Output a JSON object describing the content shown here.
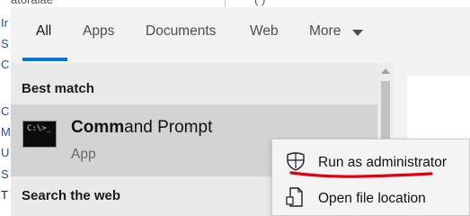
{
  "background": {
    "left_letters": [
      "Ir",
      "S",
      "C",
      "C",
      "M",
      "U",
      "S",
      "T"
    ],
    "top_fragment_left": "atoraiae",
    "top_fragment_right": "( )"
  },
  "tabs": [
    {
      "label": "All",
      "active": true
    },
    {
      "label": "Apps",
      "active": false
    },
    {
      "label": "Documents",
      "active": false
    },
    {
      "label": "Web",
      "active": false
    },
    {
      "label": "More",
      "active": false
    }
  ],
  "best_match": {
    "heading": "Best match",
    "item": {
      "title_bold": "Comm",
      "title_rest": "and Prompt",
      "subtitle": "App",
      "icon": "command-prompt-icon"
    }
  },
  "search_web": {
    "heading": "Search the web"
  },
  "context_menu": {
    "items": [
      {
        "label": "Run as administrator",
        "icon": "shield-icon"
      },
      {
        "label": "Open file location",
        "icon": "file-location-icon"
      }
    ],
    "annotation_color": "#e0000f"
  },
  "colors": {
    "accent": "#0078d4",
    "panel_bg": "#f2f2f2",
    "selected_row": "#d3d3d3"
  }
}
